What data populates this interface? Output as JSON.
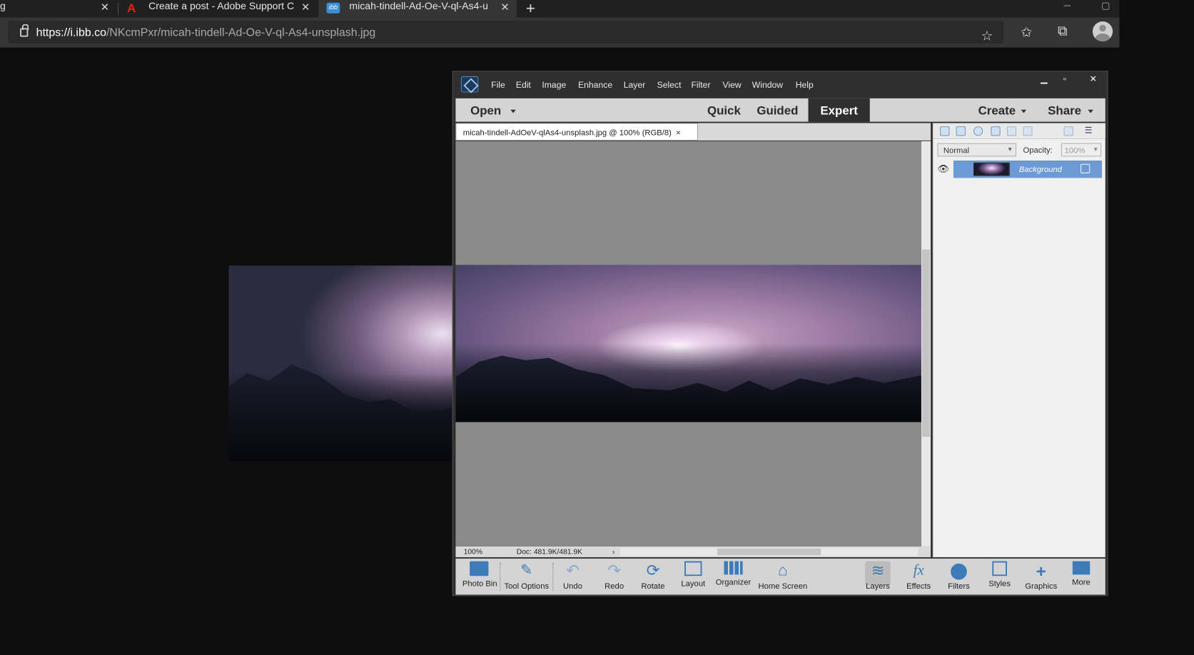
{
  "browser": {
    "tabs": [
      {
        "title": "g",
        "active": false
      },
      {
        "title": "Create a post - Adobe Support C",
        "active": false
      },
      {
        "title": "micah-tindell-Ad-Oe-V-ql-As4-u",
        "active": true
      }
    ],
    "new_tab_icon": "plus-icon",
    "url_host": "https://i.ibb.co",
    "url_path": "/NKcmPxr/micah-tindell-Ad-Oe-V-ql-As4-unsplash.jpg",
    "icons": [
      "lock-icon",
      "add-favorite-icon",
      "favorites-icon",
      "collections-icon",
      "profile-avatar"
    ]
  },
  "pse": {
    "menu": [
      "File",
      "Edit",
      "Image",
      "Enhance",
      "Layer",
      "Select",
      "Filter",
      "View",
      "Window",
      "Help"
    ],
    "window_controls": {
      "minimize": "▁",
      "maximize": "▫",
      "close": "✕"
    },
    "mode_bar": {
      "open": "Open",
      "quick": "Quick",
      "guided": "Guided",
      "expert": "Expert",
      "create": "Create",
      "share": "Share"
    },
    "doc_tab": "micah-tindell-AdOeV-qlAs4-unsplash.jpg @ 100% (RGB/8)",
    "doc_tab_close": "×",
    "status": {
      "zoom": "100%",
      "doc": "Doc: 481.9K/481.9K",
      "arrow": "›"
    },
    "layers": {
      "blend_mode": "Normal",
      "opacity_label": "Opacity:",
      "opacity_value": "100%",
      "layer_name": "Background"
    },
    "taskbar_left": [
      "Photo Bin",
      "Tool Options",
      "Undo",
      "Redo",
      "Rotate",
      "Layout",
      "Organizer",
      "Home Screen"
    ],
    "taskbar_right": [
      "Layers",
      "Effects",
      "Filters",
      "Styles",
      "Graphics",
      "More"
    ],
    "accent": "#6d9ad6"
  }
}
